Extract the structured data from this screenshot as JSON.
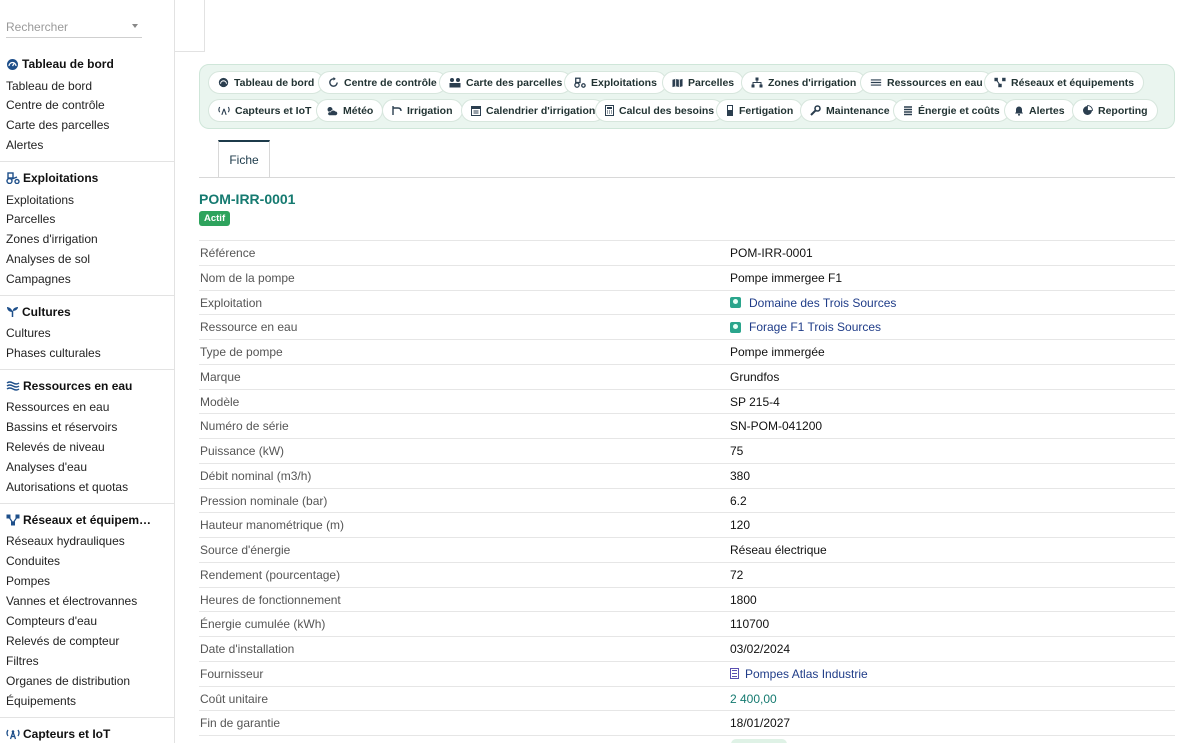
{
  "search": {
    "placeholder": "Rechercher"
  },
  "sidebar": {
    "sections": [
      {
        "title": "Tableau de bord",
        "icon": "gauge-icon",
        "items": [
          "Tableau de bord",
          "Centre de contrôle",
          "Carte des parcelles",
          "Alertes"
        ]
      },
      {
        "title": "Exploitations",
        "icon": "tractor-icon",
        "items": [
          "Exploitations",
          "Parcelles",
          "Zones d'irrigation",
          "Analyses de sol",
          "Campagnes"
        ]
      },
      {
        "title": "Cultures",
        "icon": "sprout-icon",
        "items": [
          "Cultures",
          "Phases culturales"
        ]
      },
      {
        "title": "Ressources en eau",
        "icon": "water-icon",
        "items": [
          "Ressources en eau",
          "Bassins et réservoirs",
          "Relevés de niveau",
          "Analyses d'eau",
          "Autorisations et quotas"
        ]
      },
      {
        "title": "Réseaux et équipem…",
        "icon": "network-icon",
        "items": [
          "Réseaux hydrauliques",
          "Conduites",
          "Pompes",
          "Vannes et électrovannes",
          "Compteurs d'eau",
          "Relevés de compteur",
          "Filtres",
          "Organes de distribution",
          "Équipements"
        ]
      },
      {
        "title": "Capteurs et IoT",
        "icon": "sensor-icon",
        "items": []
      }
    ]
  },
  "nav": {
    "row1": [
      {
        "label": "Tableau de bord",
        "icon": "gauge-icon"
      },
      {
        "label": "Centre de contrôle",
        "icon": "refresh-icon"
      },
      {
        "label": "Carte des parcelles",
        "icon": "map-pins-icon"
      },
      {
        "label": "Exploitations",
        "icon": "tractor-icon"
      },
      {
        "label": "Parcelles",
        "icon": "map-icon"
      },
      {
        "label": "Zones d'irrigation",
        "icon": "sitemap-icon"
      },
      {
        "label": "Ressources en eau",
        "icon": "water-icon"
      },
      {
        "label": "Réseaux et équipements",
        "icon": "network-icon"
      }
    ],
    "row2": [
      {
        "label": "Capteurs et IoT",
        "icon": "sensor-icon"
      },
      {
        "label": "Météo",
        "icon": "cloud-sun-icon"
      },
      {
        "label": "Irrigation",
        "icon": "faucet-icon"
      },
      {
        "label": "Calendrier d'irrigation",
        "icon": "calendar-icon"
      },
      {
        "label": "Calcul des besoins",
        "icon": "calculator-icon"
      },
      {
        "label": "Fertigation",
        "icon": "flask-icon"
      },
      {
        "label": "Maintenance",
        "icon": "wrench-icon"
      },
      {
        "label": "Énergie et coûts",
        "icon": "coins-icon"
      },
      {
        "label": "Alertes",
        "icon": "bell-icon"
      },
      {
        "label": "Reporting",
        "icon": "pie-chart-icon"
      }
    ]
  },
  "tabs": {
    "fiche": "Fiche"
  },
  "record": {
    "title": "POM-IRR-0001",
    "status": "Actif",
    "fields": [
      {
        "label": "Référence",
        "value": "POM-IRR-0001",
        "type": "text"
      },
      {
        "label": "Nom de la pompe",
        "value": "Pompe immergee F1",
        "type": "text"
      },
      {
        "label": "Exploitation",
        "value": "Domaine des Trois Sources",
        "type": "link"
      },
      {
        "label": "Ressource en eau",
        "value": "Forage F1 Trois Sources",
        "type": "link"
      },
      {
        "label": "Type de pompe",
        "value": "Pompe immergée",
        "type": "text"
      },
      {
        "label": "Marque",
        "value": "Grundfos",
        "type": "text"
      },
      {
        "label": "Modèle",
        "value": "SP 215-4",
        "type": "text"
      },
      {
        "label": "Numéro de série",
        "value": "SN-POM-041200",
        "type": "text"
      },
      {
        "label": "Puissance (kW)",
        "value": "75",
        "type": "text"
      },
      {
        "label": "Débit nominal (m3/h)",
        "value": "380",
        "type": "text"
      },
      {
        "label": "Pression nominale (bar)",
        "value": "6.2",
        "type": "text"
      },
      {
        "label": "Hauteur manométrique (m)",
        "value": "120",
        "type": "text"
      },
      {
        "label": "Source d'énergie",
        "value": "Réseau électrique",
        "type": "text"
      },
      {
        "label": "Rendement (pourcentage)",
        "value": "72",
        "type": "text"
      },
      {
        "label": "Heures de fonctionnement",
        "value": "1800",
        "type": "text"
      },
      {
        "label": "Énergie cumulée (kWh)",
        "value": "110700",
        "type": "text"
      },
      {
        "label": "Date d'installation",
        "value": "03/02/2024",
        "type": "text"
      },
      {
        "label": "Fournisseur",
        "value": "Pompes Atlas Industrie",
        "type": "supplier"
      },
      {
        "label": "Coût unitaire",
        "value": "2 400,00",
        "type": "number"
      },
      {
        "label": "Fin de garantie",
        "value": "18/01/2027",
        "type": "text"
      }
    ]
  },
  "colors": {
    "accent": "#157a70",
    "badge": "#2ea35d",
    "link": "#1f3c88",
    "nav_bg": "#eaf5ef"
  }
}
